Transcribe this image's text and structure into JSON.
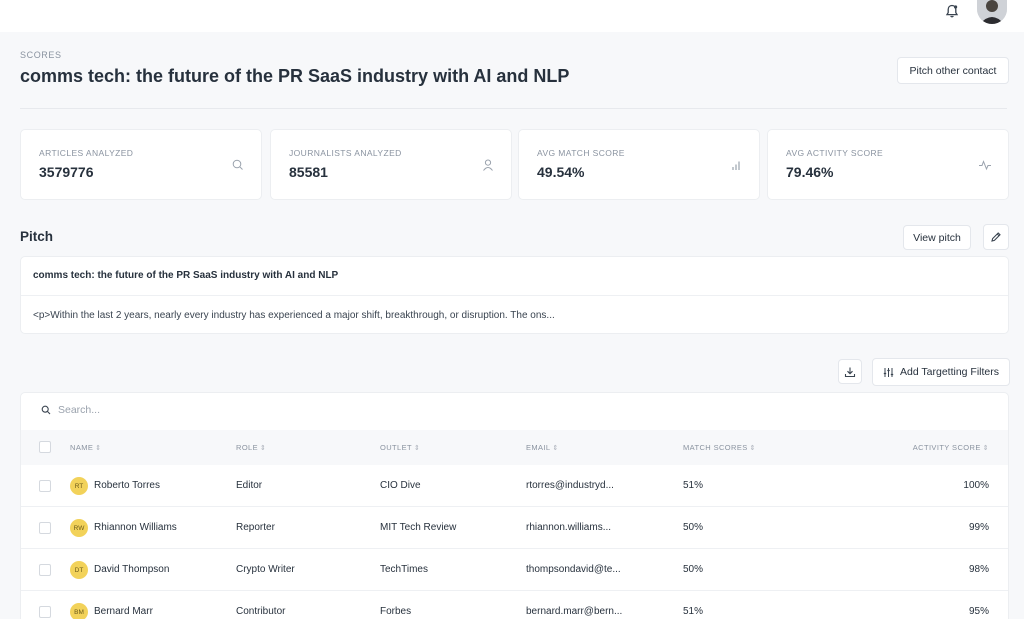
{
  "header": {
    "bell_icon": "bell-icon",
    "avatar_icon": "user-avatar"
  },
  "page": {
    "eyebrow": "SCORES",
    "title": "comms tech: the future of the PR SaaS industry with AI and NLP",
    "pitch_other_label": "Pitch other contact"
  },
  "stats": [
    {
      "label": "ARTICLES ANALYZED",
      "value": "3579776",
      "icon": "search-icon"
    },
    {
      "label": "JOURNALISTS ANALYZED",
      "value": "85581",
      "icon": "user-icon"
    },
    {
      "label": "AVG MATCH SCORE",
      "value": "49.54%",
      "icon": "bar-chart-icon"
    },
    {
      "label": "AVG ACTIVITY SCORE",
      "value": "79.46%",
      "icon": "activity-icon"
    }
  ],
  "pitch": {
    "section_title": "Pitch",
    "view_label": "View pitch",
    "subject": "comms tech: the future of the PR SaaS industry with AI and NLP",
    "body": "<p>Within the last 2 years, nearly every industry has experienced a major shift, breakthrough, or disruption. The ons..."
  },
  "toolbar": {
    "filters_label": "Add Targetting Filters"
  },
  "table": {
    "search_placeholder": "Search...",
    "columns": [
      "NAME",
      "ROLE",
      "OUTLET",
      "EMAIL",
      "MATCH SCORES",
      "ACTIVITY SCORE"
    ],
    "rows": [
      {
        "initials": "RT",
        "name": "Roberto Torres",
        "role": "Editor",
        "outlet": "CIO Dive",
        "email": "rtorres@industryd...",
        "match": "51%",
        "activity": "100%"
      },
      {
        "initials": "RW",
        "name": "Rhiannon Williams",
        "role": "Reporter",
        "outlet": "MIT Tech Review",
        "email": "rhiannon.williams...",
        "match": "50%",
        "activity": "99%"
      },
      {
        "initials": "DT",
        "name": "David Thompson",
        "role": "Crypto Writer",
        "outlet": "TechTimes",
        "email": "thompsondavid@te...",
        "match": "50%",
        "activity": "98%"
      },
      {
        "initials": "BM",
        "name": "Bernard Marr",
        "role": "Contributor",
        "outlet": "Forbes",
        "email": "bernard.marr@bern...",
        "match": "51%",
        "activity": "95%"
      }
    ]
  },
  "colors": {
    "accent_avatar": "#f2d25a",
    "background": "#f7f8fa",
    "card": "#ffffff"
  }
}
